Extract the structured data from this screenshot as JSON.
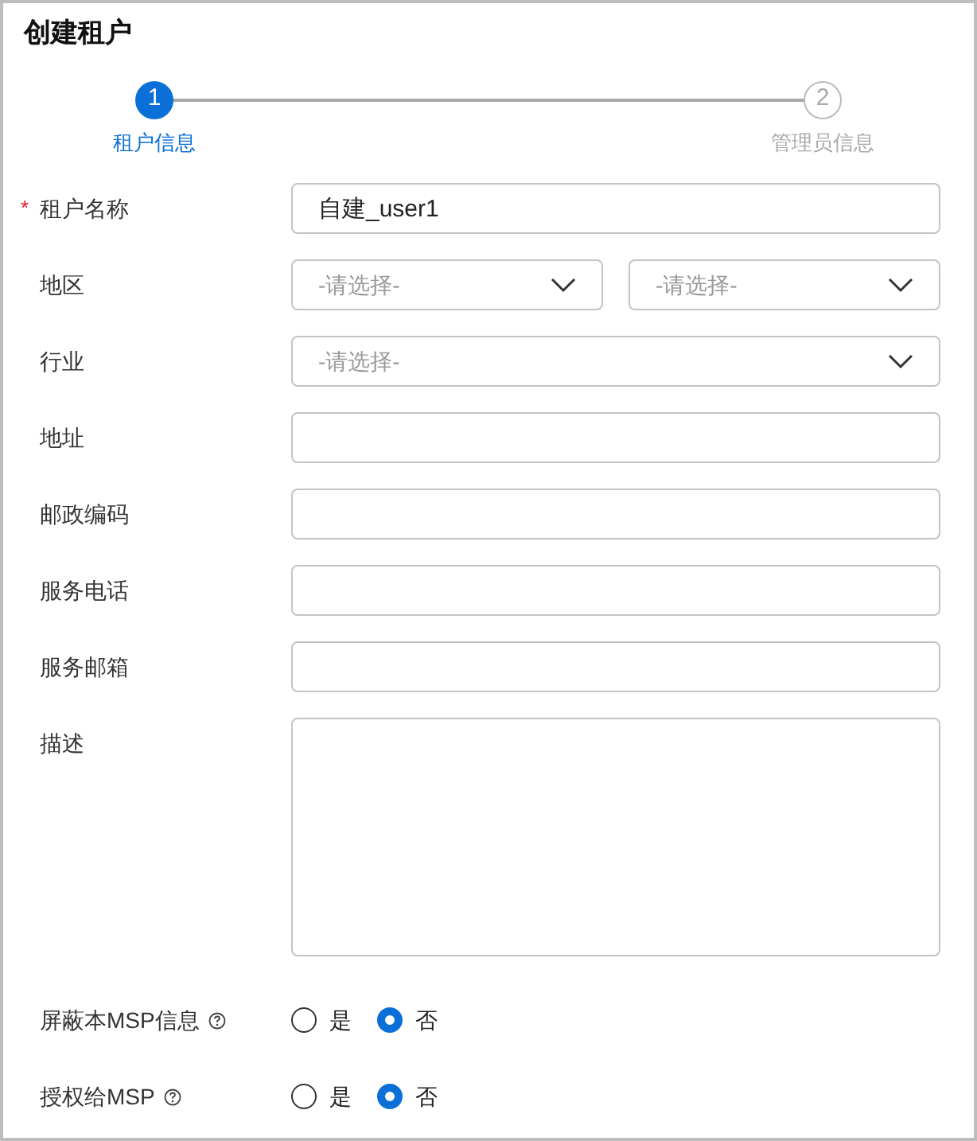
{
  "title": "创建租户",
  "steps": [
    {
      "number": "1",
      "label": "租户信息",
      "selected": true
    },
    {
      "number": "2",
      "label": "管理员信息",
      "selected": false
    }
  ],
  "fields": [
    {
      "kind": "text",
      "label": "租户名称",
      "required_mark": "*",
      "value": "自建_user1"
    },
    {
      "kind": "select",
      "label": "地区",
      "selects": [
        {
          "placeholder": "-请选择-"
        },
        {
          "placeholder": "-请选择-"
        }
      ]
    },
    {
      "kind": "select",
      "label": "行业",
      "selects": [
        {
          "placeholder": "-请选择-"
        }
      ]
    },
    {
      "kind": "text",
      "label": "地址"
    },
    {
      "kind": "text",
      "label": "邮政编码"
    },
    {
      "kind": "text",
      "label": "服务电话"
    },
    {
      "kind": "text",
      "label": "服务邮箱"
    },
    {
      "kind": "textarea",
      "label": "描述"
    },
    {
      "kind": "radio",
      "label": "屏蔽本MSP信息",
      "help": true,
      "options": [
        {
          "label": "是",
          "selected": false
        },
        {
          "label": "否",
          "selected": true
        }
      ]
    },
    {
      "kind": "radio",
      "label": "授权给MSP",
      "help": true,
      "options": [
        {
          "label": "是",
          "selected": false
        },
        {
          "label": "否",
          "selected": true
        }
      ]
    }
  ]
}
